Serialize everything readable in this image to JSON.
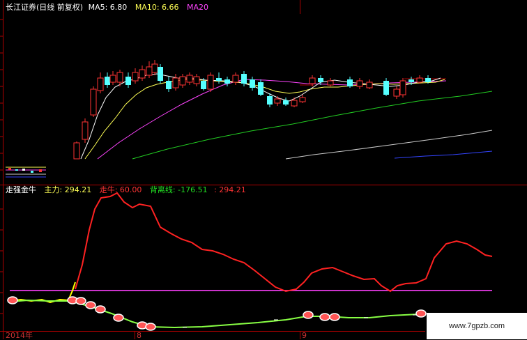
{
  "colors": {
    "bg": "#000000",
    "frame": "#b00000",
    "ma5": "#ffffff",
    "ma10": "#ffff55",
    "ma20": "#ff44ff",
    "ma60": "#22cc22",
    "ma120": "#cccccc",
    "ma250": "#3344ff",
    "up": "#ff3333",
    "down": "#55ffff",
    "main_line": "#ff2222",
    "bull_line": "#ffff00",
    "bottom_line": "#88ff44",
    "pink_line": "#cc33cc"
  },
  "top_panel": {
    "title": "长江证券(日线 前复权)",
    "ma5": "MA5: 6.80",
    "ma10": "MA10: 6.66",
    "ma20": "MA20"
  },
  "bottom_panel": {
    "indicator": "走强金牛",
    "main_force": "主力: 294.21",
    "bull": "走牛: 60.00",
    "divergence": "背离线: -176.51",
    "extra": ": 294.21"
  },
  "x_axis": {
    "year_label": "2014年",
    "month_8": "8",
    "month_9": "9"
  },
  "watermark": "www.7gpzb.com",
  "icons": {
    "signal_marker": "red-white-ball-icon"
  }
}
